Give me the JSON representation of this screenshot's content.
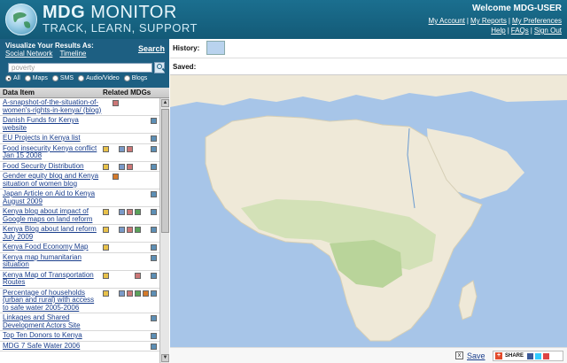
{
  "header": {
    "title_bold": "MDG",
    "title_rest": "MONITOR",
    "tagline": "TRACK, LEARN, SUPPORT",
    "welcome": "Welcome MDG-USER",
    "links_row1": [
      "My Account",
      "My Reports",
      "My Preferences"
    ],
    "links_row2": [
      "Help",
      "FAQs",
      "Sign Out"
    ],
    "separator": "|"
  },
  "left": {
    "visualize_label": "Visualize Your Results As:",
    "search_link": "Search",
    "view_links": [
      "Social Network",
      "Timeline"
    ],
    "search_value": "poverty",
    "filters": [
      {
        "label": "All",
        "selected": true
      },
      {
        "label": "Maps",
        "selected": false
      },
      {
        "label": "SMS",
        "selected": false
      },
      {
        "label": "Audio/Video",
        "selected": false
      },
      {
        "label": "Blogs",
        "selected": false
      }
    ],
    "col_data_item": "Data Item",
    "col_related": "Related MDGs",
    "items": [
      "A-snapshot-of-the-situation-of-women's-rights-in-kenya/ (blog)",
      "Danish Funds for Kenya website",
      "EU Projects in Kenya list",
      "Food insecurity Kenya conflict Jan 15 2008",
      "Food Security Distribution",
      "Gender equity blog and Kenya situation of women blog",
      "Japan Article on Aid to Kenya August 2009",
      "Kenya blog about impact of Google maps on land reform",
      "Kenya Blog about land reform July 2009",
      "Kenya Food Economy Map",
      "Kenya map humanitarian situation",
      "Kenya Map of Transportation Routes",
      "Percentage of households (urban and rural) with access to safe water 2005-2006",
      "Linkages and Shared Development Actors Site",
      "Top Ten Donors to Kenya",
      "MDG 7 Safe Water 2006"
    ],
    "scroll_up": "▲",
    "scroll_down": "▼"
  },
  "right": {
    "history_label": "History:",
    "saved_label": "Saved:",
    "save_link": "Save",
    "close_glyph": "x",
    "share_label": "SHARE",
    "share_plus": "+"
  },
  "colors": {
    "header_bg": "#1b6f8f",
    "panel_bg": "#1d5f82",
    "sea": "#a7c5e8",
    "land": "#efe9d8"
  }
}
